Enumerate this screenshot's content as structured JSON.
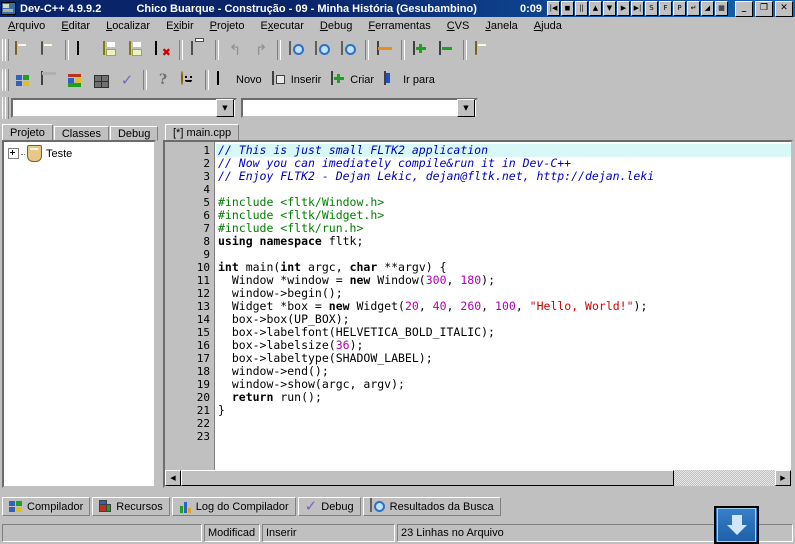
{
  "window": {
    "app_name": "Dev-C++ 4.9.9.2",
    "media_title": "Chico Buarque - Construção - 09 - Minha História (Gesubambino)",
    "media_time": "0:09",
    "media_buttons": [
      {
        "name": "prev-track",
        "glyph": "|◀"
      },
      {
        "name": "stop",
        "glyph": "◼"
      },
      {
        "name": "pause",
        "glyph": "||"
      },
      {
        "name": "volume-up",
        "glyph": "▲"
      },
      {
        "name": "volume-down",
        "glyph": "▼"
      },
      {
        "name": "play",
        "glyph": "▶"
      },
      {
        "name": "next-track",
        "glyph": "▶|"
      },
      {
        "name": "shuffle",
        "glyph": "S"
      },
      {
        "name": "fade",
        "glyph": "F"
      },
      {
        "name": "playlist",
        "glyph": "P"
      },
      {
        "name": "repeat",
        "glyph": "↵"
      },
      {
        "name": "skin",
        "glyph": "◢"
      },
      {
        "name": "equalizer",
        "glyph": "▦"
      }
    ],
    "controls": [
      {
        "name": "minimize-button",
        "glyph": "_"
      },
      {
        "name": "restore-button",
        "glyph": "❐"
      },
      {
        "name": "close-button",
        "glyph": "✕"
      }
    ]
  },
  "menu": [
    {
      "label": "Arquivo",
      "accel": "A"
    },
    {
      "label": "Editar",
      "accel": "E"
    },
    {
      "label": "Localizar",
      "accel": "L"
    },
    {
      "label": "Exibir",
      "accel": "x"
    },
    {
      "label": "Projeto",
      "accel": "P"
    },
    {
      "label": "Executar",
      "accel": "x"
    },
    {
      "label": "Debug",
      "accel": "D"
    },
    {
      "label": "Ferramentas",
      "accel": "F"
    },
    {
      "label": "CVS",
      "accel": "C"
    },
    {
      "label": "Janela",
      "accel": "J"
    },
    {
      "label": "Ajuda",
      "accel": "A"
    }
  ],
  "toolbar1": [
    {
      "name": "new-project-button",
      "icon": "shield-icon"
    },
    {
      "name": "open-project-button",
      "icon": "open-folder-icon"
    },
    {
      "name": "new-file-button",
      "icon": "page-icon"
    },
    {
      "name": "save-button",
      "icon": "floppy-disk-icon"
    },
    {
      "name": "save-all-button",
      "icon": "save-all-icon"
    },
    {
      "name": "close-button",
      "icon": "close-red-x-icon"
    },
    {
      "name": "print-button",
      "icon": "printer-icon"
    },
    {
      "name": "undo-button",
      "icon": "undo-arrow-icon"
    },
    {
      "name": "redo-button",
      "icon": "redo-arrow-icon"
    },
    {
      "name": "find-button",
      "icon": "find-magnifier-icon"
    },
    {
      "name": "find-next-button",
      "icon": "find-next-magnifier-icon"
    },
    {
      "name": "replace-button",
      "icon": "replace-magnifier-icon"
    },
    {
      "name": "goto-line-button",
      "icon": "goto-line-icon"
    },
    {
      "name": "add-to-project-button",
      "icon": "plus-green-icon"
    },
    {
      "name": "remove-from-project-button",
      "icon": "minus-green-icon"
    },
    {
      "name": "project-options-button",
      "icon": "shield-options-icon"
    }
  ],
  "toolbar2": [
    {
      "name": "compile-button",
      "icon": "compile-blocks-icon"
    },
    {
      "name": "run-button",
      "icon": "run-window-icon"
    },
    {
      "name": "compile-and-run-button",
      "icon": "compile-run-icon"
    },
    {
      "name": "rebuild-all-button",
      "icon": "rebuild-blocks-icon"
    },
    {
      "name": "syntax-check-button",
      "icon": "check-mark-icon"
    },
    {
      "name": "help-button",
      "icon": "question-mark-icon"
    },
    {
      "name": "about-button",
      "icon": "smiley-icon"
    },
    {
      "name": "new-button",
      "label": "Novo",
      "icon": "page-icon"
    },
    {
      "name": "insert-button",
      "label": "Inserir",
      "icon": "insert-icon"
    },
    {
      "name": "create-button",
      "label": "Criar",
      "icon": "create-plus-icon"
    },
    {
      "name": "goto-button",
      "label": "Ir para",
      "icon": "goto-icon"
    }
  ],
  "combos": {
    "class_browser": {
      "value": "",
      "placeholder": ""
    },
    "member_browser": {
      "value": "",
      "placeholder": ""
    }
  },
  "left_tabs": [
    {
      "label": "Projeto",
      "active": true
    },
    {
      "label": "Classes",
      "active": false
    },
    {
      "label": "Debug",
      "active": false
    }
  ],
  "project_tree": [
    {
      "label": "Teste",
      "icon": "project-shield-icon",
      "expanded": false
    }
  ],
  "editor_tabs": [
    {
      "label": "[*] main.cpp",
      "active": true
    }
  ],
  "code": {
    "total_lines": 23,
    "current_line": 1,
    "lines": [
      {
        "n": "1",
        "cur": true,
        "tokens": [
          {
            "t": "// This is just small FLTK2 application",
            "c": "com"
          }
        ]
      },
      {
        "n": "2",
        "cur": false,
        "tokens": [
          {
            "t": "// Now you can imediately compile&run it in Dev-C++",
            "c": "com"
          }
        ]
      },
      {
        "n": "3",
        "cur": false,
        "tokens": [
          {
            "t": "// Enjoy FLTK2 - Dejan Lekic, dejan@fltk.net, http://dejan.leki",
            "c": "com"
          }
        ]
      },
      {
        "n": "4",
        "cur": false,
        "tokens": []
      },
      {
        "n": "5",
        "cur": false,
        "tokens": [
          {
            "t": "#include <fltk/Window.h>",
            "c": "pre"
          }
        ]
      },
      {
        "n": "6",
        "cur": false,
        "tokens": [
          {
            "t": "#include <fltk/Widget.h>",
            "c": "pre"
          }
        ]
      },
      {
        "n": "7",
        "cur": false,
        "tokens": [
          {
            "t": "#include <fltk/run.h>",
            "c": "pre"
          }
        ]
      },
      {
        "n": "8",
        "cur": false,
        "tokens": [
          {
            "t": "using namespace",
            "c": "kw"
          },
          {
            "t": " fltk;",
            "c": "pl"
          }
        ]
      },
      {
        "n": "9",
        "cur": false,
        "tokens": []
      },
      {
        "n": "10",
        "cur": false,
        "tokens": [
          {
            "t": "int",
            "c": "kw"
          },
          {
            "t": " main(",
            "c": "pl"
          },
          {
            "t": "int",
            "c": "kw"
          },
          {
            "t": " argc, ",
            "c": "pl"
          },
          {
            "t": "char",
            "c": "kw"
          },
          {
            "t": " **argv) {",
            "c": "pl"
          }
        ]
      },
      {
        "n": "11",
        "cur": false,
        "tokens": [
          {
            "t": "  Window *window = ",
            "c": "pl"
          },
          {
            "t": "new",
            "c": "kw"
          },
          {
            "t": " Window(",
            "c": "pl"
          },
          {
            "t": "300",
            "c": "num"
          },
          {
            "t": ", ",
            "c": "pl"
          },
          {
            "t": "180",
            "c": "num"
          },
          {
            "t": ");",
            "c": "pl"
          }
        ]
      },
      {
        "n": "12",
        "cur": false,
        "tokens": [
          {
            "t": "  window->begin();",
            "c": "pl"
          }
        ]
      },
      {
        "n": "13",
        "cur": false,
        "tokens": [
          {
            "t": "  Widget *box = ",
            "c": "pl"
          },
          {
            "t": "new",
            "c": "kw"
          },
          {
            "t": " Widget(",
            "c": "pl"
          },
          {
            "t": "20",
            "c": "num"
          },
          {
            "t": ", ",
            "c": "pl"
          },
          {
            "t": "40",
            "c": "num"
          },
          {
            "t": ", ",
            "c": "pl"
          },
          {
            "t": "260",
            "c": "num"
          },
          {
            "t": ", ",
            "c": "pl"
          },
          {
            "t": "100",
            "c": "num"
          },
          {
            "t": ", ",
            "c": "pl"
          },
          {
            "t": "\"Hello, World!\"",
            "c": "str"
          },
          {
            "t": ");",
            "c": "pl"
          }
        ]
      },
      {
        "n": "14",
        "cur": false,
        "tokens": [
          {
            "t": "  box->box(UP_BOX);",
            "c": "pl"
          }
        ]
      },
      {
        "n": "15",
        "cur": false,
        "tokens": [
          {
            "t": "  box->labelfont(HELVETICA_BOLD_ITALIC);",
            "c": "pl"
          }
        ]
      },
      {
        "n": "16",
        "cur": false,
        "tokens": [
          {
            "t": "  box->labelsize(",
            "c": "pl"
          },
          {
            "t": "36",
            "c": "num"
          },
          {
            "t": ");",
            "c": "pl"
          }
        ]
      },
      {
        "n": "17",
        "cur": false,
        "tokens": [
          {
            "t": "  box->labeltype(SHADOW_LABEL);",
            "c": "pl"
          }
        ]
      },
      {
        "n": "18",
        "cur": false,
        "tokens": [
          {
            "t": "  window->end();",
            "c": "pl"
          }
        ]
      },
      {
        "n": "19",
        "cur": false,
        "tokens": [
          {
            "t": "  window->show(argc, argv);",
            "c": "pl"
          }
        ]
      },
      {
        "n": "20",
        "cur": false,
        "tokens": [
          {
            "t": "  ",
            "c": "pl"
          },
          {
            "t": "return",
            "c": "kw"
          },
          {
            "t": " run();",
            "c": "pl"
          }
        ]
      },
      {
        "n": "21",
        "cur": false,
        "tokens": [
          {
            "t": "}",
            "c": "pl"
          }
        ]
      },
      {
        "n": "22",
        "cur": false,
        "tokens": []
      },
      {
        "n": "23",
        "cur": false,
        "tokens": []
      }
    ]
  },
  "bottom_tabs": [
    {
      "label": "Compilador",
      "icon": "compile-blocks-icon"
    },
    {
      "label": "Recursos",
      "icon": "resources-icon"
    },
    {
      "label": "Log do Compilador",
      "icon": "log-bars-icon"
    },
    {
      "label": "Debug",
      "icon": "check-mark-icon"
    },
    {
      "label": "Resultados da Busca",
      "icon": "search-results-icon"
    }
  ],
  "statusbar": {
    "cursor": "",
    "modified": "Modificad",
    "insert_mode": "Inserir",
    "line_count": "23 Linhas no Arquivo"
  },
  "download_widget": {
    "name": "download-arrow-icon"
  },
  "colors": {
    "title_start": "#0a246a",
    "title_end": "#1464b4",
    "face": "#c0c0c0",
    "comment": "#0000c0",
    "preprocessor": "#008000",
    "number": "#b000b0",
    "string": "#d00000",
    "current_line": "#d8f8f8"
  }
}
